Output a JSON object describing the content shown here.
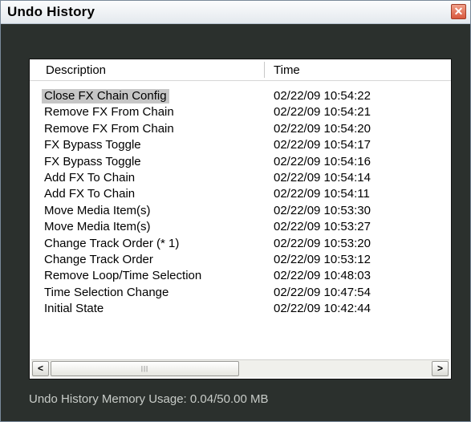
{
  "window": {
    "title": "Undo History",
    "close_glyph": "✕"
  },
  "columns": {
    "description": "Description",
    "time": "Time"
  },
  "rows": [
    {
      "description": "Close FX Chain Config",
      "time": "02/22/09 10:54:22",
      "selected": true
    },
    {
      "description": "Remove FX From Chain",
      "time": "02/22/09 10:54:21"
    },
    {
      "description": "Remove FX From Chain",
      "time": "02/22/09 10:54:20"
    },
    {
      "description": "FX Bypass Toggle",
      "time": "02/22/09 10:54:17"
    },
    {
      "description": "FX Bypass Toggle",
      "time": "02/22/09 10:54:16"
    },
    {
      "description": "Add FX To Chain",
      "time": "02/22/09 10:54:14"
    },
    {
      "description": "Add FX To Chain",
      "time": "02/22/09 10:54:11"
    },
    {
      "description": "Move Media Item(s)",
      "time": "02/22/09 10:53:30"
    },
    {
      "description": "Move Media Item(s)",
      "time": "02/22/09 10:53:27"
    },
    {
      "description": "Change Track Order (* 1)",
      "time": "02/22/09 10:53:20"
    },
    {
      "description": "Change Track Order",
      "time": "02/22/09 10:53:12"
    },
    {
      "description": "Remove Loop/Time Selection",
      "time": "02/22/09 10:48:03"
    },
    {
      "description": "Time Selection Change",
      "time": "02/22/09 10:47:54"
    },
    {
      "description": "Initial State",
      "time": "02/22/09 10:42:44"
    }
  ],
  "scrollbar": {
    "left_glyph": "<",
    "right_glyph": ">",
    "grip_glyph": "|||"
  },
  "status": {
    "memory_usage": "Undo History Memory Usage: 0.04/50.00 MB"
  },
  "colors": {
    "window_bg": "#2b302d",
    "selection": "#c6c6c6",
    "close_button": "#d8573d"
  }
}
